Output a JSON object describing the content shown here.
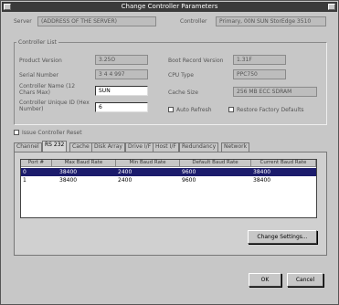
{
  "window": {
    "title": "Change Controller Parameters"
  },
  "header": {
    "server_label": "Server",
    "server_value": "(ADDRESS OF THE SERVER)",
    "controller_label": "Controller",
    "controller_value": "Primary, 00N SUN StorEdge 3510"
  },
  "controller_list": {
    "group_label": "Controller List",
    "product_version_label": "Product Version",
    "product_version_value": "3.25O",
    "serial_number_label": "Serial Number",
    "serial_number_value": "3 4 4 997",
    "controller_name_label": "Controller Name (12 Chars Max)",
    "controller_name_value": "SUN",
    "controller_unique_id_label": "Controller Unique ID (Hex Number)",
    "controller_unique_id_value": "6",
    "boot_record_label": "Boot Record Version",
    "boot_record_value": "1.31F",
    "cpu_type_label": "CPU Type",
    "cpu_type_value": "PPC750",
    "cache_size_label": "Cache Size",
    "cache_size_value": "256 MB ECC SDRAM",
    "auto_refresh_label": "Auto Refresh",
    "restore_defaults_label": "Restore Factory Defaults"
  },
  "issue_reset_label": "Issue Controller Reset",
  "tabs": [
    "Channel",
    "RS 232",
    "Cache",
    "Disk Array",
    "Drive I/F",
    "Host I/F",
    "Redundancy",
    "Network"
  ],
  "table": {
    "columns": [
      "Port #",
      "Max Baud Rate",
      "Min Baud Rate",
      "Default Baud Rate",
      "Current Baud Rate"
    ],
    "rows": [
      [
        "0",
        "38400",
        "2400",
        "9600",
        "38400"
      ],
      [
        "1",
        "38400",
        "2400",
        "9600",
        "38400"
      ]
    ]
  },
  "buttons": {
    "change_settings": "Change Settings...",
    "ok": "OK",
    "cancel": "Cancel"
  }
}
